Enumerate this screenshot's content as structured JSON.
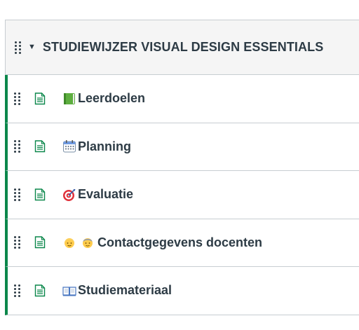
{
  "module": {
    "title": "STUDIEWIJZER VISUAL DESIGN ESSENTIALS",
    "collapse_state": "expanded"
  },
  "items": [
    {
      "label": "Leerdoelen",
      "type": "page",
      "icons": [
        "green-book-icon"
      ]
    },
    {
      "label": "Planning",
      "type": "page",
      "icons": [
        "calendar-icon"
      ]
    },
    {
      "label": "Evaluatie",
      "type": "page",
      "icons": [
        "dart-target-icon"
      ]
    },
    {
      "label": "Contactgegevens docenten",
      "type": "page",
      "icons": [
        "person-blond-icon",
        "older-person-icon"
      ]
    },
    {
      "label": "Studiemateriaal",
      "type": "page",
      "icons": [
        "open-book-icon"
      ]
    }
  ],
  "colors": {
    "published_indicator": "#0b874b",
    "page_icon": "#0b874b",
    "header_bg": "#f5f5f5",
    "text": "#2d3b45"
  }
}
